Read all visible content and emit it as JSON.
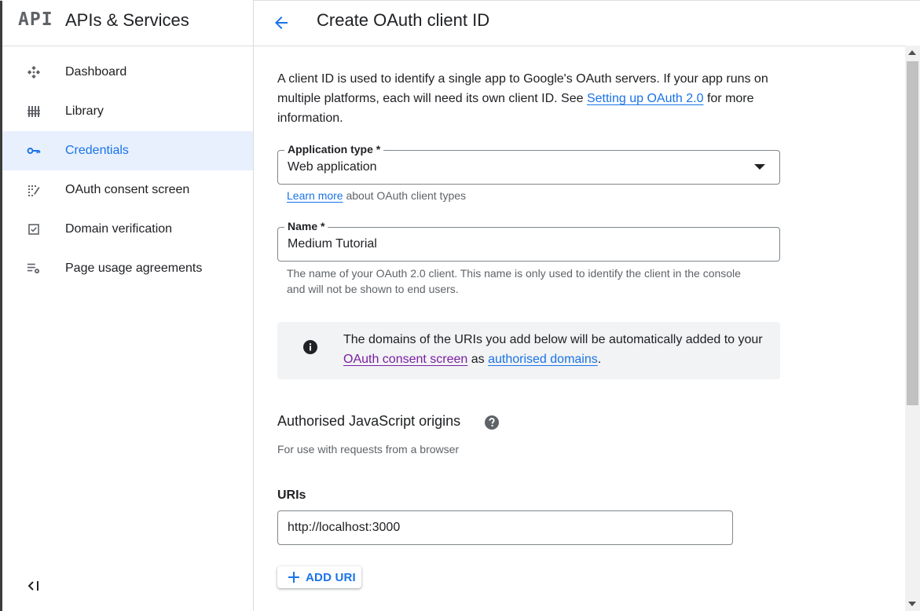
{
  "sidebar": {
    "logo": "API",
    "title": "APIs & Services",
    "items": [
      {
        "label": "Dashboard",
        "icon": "dashboard-icon"
      },
      {
        "label": "Library",
        "icon": "library-icon"
      },
      {
        "label": "Credentials",
        "icon": "key-icon",
        "active": true
      },
      {
        "label": "OAuth consent screen",
        "icon": "consent-icon"
      },
      {
        "label": "Domain verification",
        "icon": "checkbox-icon"
      },
      {
        "label": "Page usage agreements",
        "icon": "settings-list-icon"
      }
    ],
    "collapse_icon": "collapse-icon"
  },
  "header": {
    "title": "Create OAuth client ID",
    "back_icon": "back-arrow-icon"
  },
  "intro": {
    "text1": "A client ID is used to identify a single app to Google's OAuth servers. If your app runs on multiple platforms, each will need its own client ID. See ",
    "link": "Setting up OAuth 2.0",
    "text2": " for more information."
  },
  "app_type": {
    "label": "Application type *",
    "value": "Web application",
    "hint_link": "Learn more",
    "hint_text": " about OAuth client types"
  },
  "name_field": {
    "label": "Name *",
    "value": "Medium Tutorial",
    "hint": "The name of your OAuth 2.0 client. This name is only used to identify the client in the console and will not be shown to end users."
  },
  "notice": {
    "text1": "The domains of the URIs you add below will be automatically added to your ",
    "link1": "OAuth consent screen",
    "text2": " as ",
    "link2": "authorised domains",
    "text3": "."
  },
  "js_origins": {
    "title": "Authorised JavaScript origins",
    "subtitle": "For use with requests from a browser",
    "uris_label": "URIs",
    "uri_value": "http://localhost:3000",
    "add_button": "ADD URI"
  },
  "colors": {
    "accent": "#1a73e8",
    "active_bg": "#e8f0fe",
    "visited_link": "#7b1fa2"
  }
}
